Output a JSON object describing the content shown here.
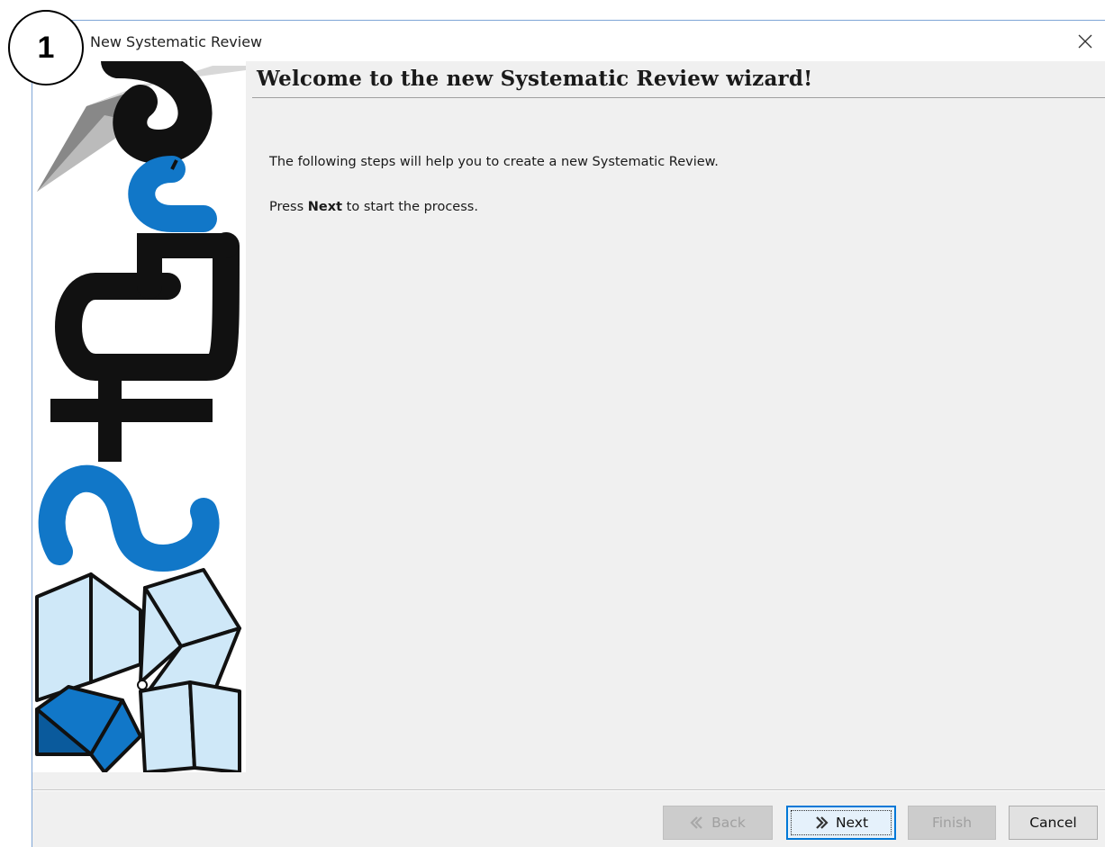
{
  "window": {
    "title": "New Systematic Review"
  },
  "annotation": {
    "step_number": "1"
  },
  "wizard": {
    "heading": "Welcome to the new Systematic Review wizard!",
    "line1": "The following steps will help you to create a new Systematic Review.",
    "line2_prefix": "Press ",
    "line2_bold": "Next",
    "line2_suffix": " to start the process."
  },
  "buttons": {
    "back": "Back",
    "next": "Next",
    "finish": "Finish",
    "cancel": "Cancel"
  },
  "colors": {
    "accent": "#0078d7",
    "logo_blue": "#1177c8",
    "logo_light_blue": "#cfe8f8",
    "logo_dark": "#111111"
  }
}
